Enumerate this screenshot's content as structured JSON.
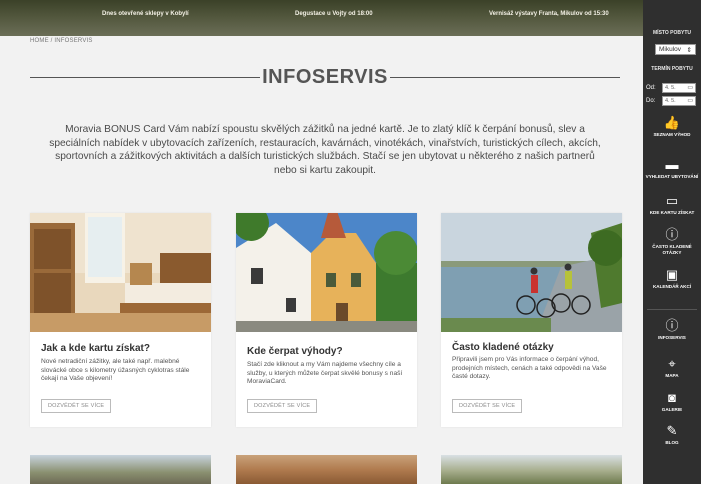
{
  "topbar": {
    "announcements": [
      "Dnes otevřené sklepy v Kobylí",
      "Degustace u Vojty od 18:00",
      "Vernisáž výstavy Franta, Mikulov od 15:30"
    ]
  },
  "sidebar": {
    "stay_place_label": "MÍSTO POBYTU",
    "stay_place_value": "Mikulov",
    "stay_term_label": "TERMÍN POBYTU",
    "from_label": "Od:",
    "from_value": "4. 5.",
    "to_label": "Do:",
    "to_value": "4. 5.",
    "items": [
      {
        "label": "SEZNAM VÝHOD",
        "icon": "thumbs-up-icon"
      },
      {
        "label": "VYHLEDAT UBYTOVÁNÍ",
        "icon": "bed-icon"
      },
      {
        "label": "KDE KARTU ZÍSKAT",
        "icon": "card-icon"
      },
      {
        "label": "ČASTO KLADENÉ OTÁZKY",
        "icon": "question-icon"
      },
      {
        "label": "KALENDÁŘ AKCÍ",
        "icon": "calendar-icon"
      },
      {
        "label": "INFOSERVIS",
        "icon": "info-icon"
      },
      {
        "label": "MAPA",
        "icon": "map-icon"
      },
      {
        "label": "GALERIE",
        "icon": "camera-icon"
      },
      {
        "label": "BLOG",
        "icon": "blog-icon"
      }
    ]
  },
  "breadcrumb": "HOME  /  INFOSERVIS",
  "page": {
    "title": "INFOSERVIS",
    "intro": "Moravia BONUS Card Vám nabízí spoustu skvělých zážitků na jedné kartě. Je to zlatý klíč k čerpání bonusů, slev a speciálních nabídek v ubytovacích zařízeních, restauracích, kavárnách, vinotékách, vinařstvích, turistických cílech, akcích, sportovních a zážitkových aktivitách a dalších turistických službách. Stačí se jen ubytovat u některého z našich partnerů nebo si kartu zakoupit."
  },
  "cards": [
    {
      "title": "Jak a kde kartu získat?",
      "text": "Nové netradiční zážitky, ale také např. malebné slovácké obce s kilometry úžasných cyklotras stále čekají na Vaše objevení!",
      "button": "DOZVĚDĚT SE VÍCE"
    },
    {
      "title": "Kde čerpat výhody?",
      "text": "Stačí zde kliknout a my Vám najdeme všechny cíle a služby, u kterých můžete čerpat skvělé bonusy s naší MoraviaCard.",
      "button": "DOZVĚDĚT SE VÍCE"
    },
    {
      "title": "Často kladené otázky",
      "text": "Připravili jsem pro Vás informace o čerpání výhod, prodejních místech, cenách a také odpovědi na Vaše časté dotazy.",
      "button": "DOZVĚDĚT SE VÍCE"
    }
  ]
}
